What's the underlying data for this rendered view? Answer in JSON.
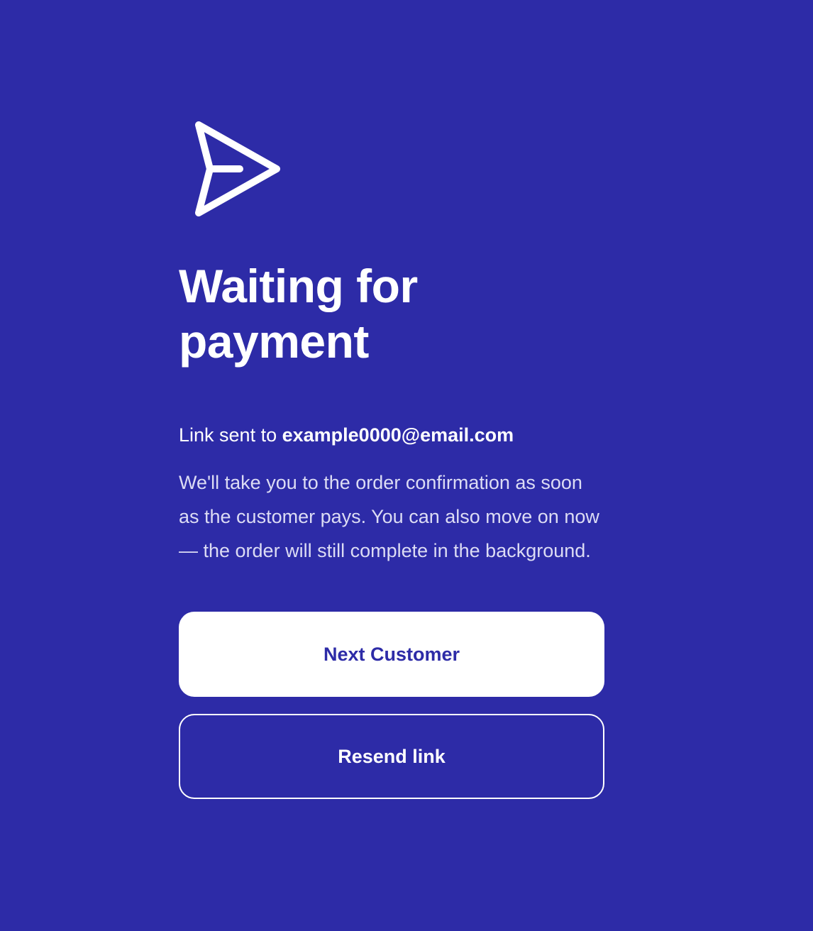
{
  "icon": "send-icon",
  "colors": {
    "background": "#2d2ba7",
    "primary_button_bg": "#ffffff",
    "primary_button_text": "#2d2ba7",
    "text": "#ffffff"
  },
  "title_line1": "Waiting for",
  "title_line2": "payment",
  "sent_prefix": "Link sent to",
  "email": "example0000@email.com",
  "description": "We'll take you to the order confirmation as soon as the customer pays. You can also move on now — the order will still complete in the background.",
  "buttons": {
    "primary_label": "Next Customer",
    "secondary_label": "Resend link"
  }
}
